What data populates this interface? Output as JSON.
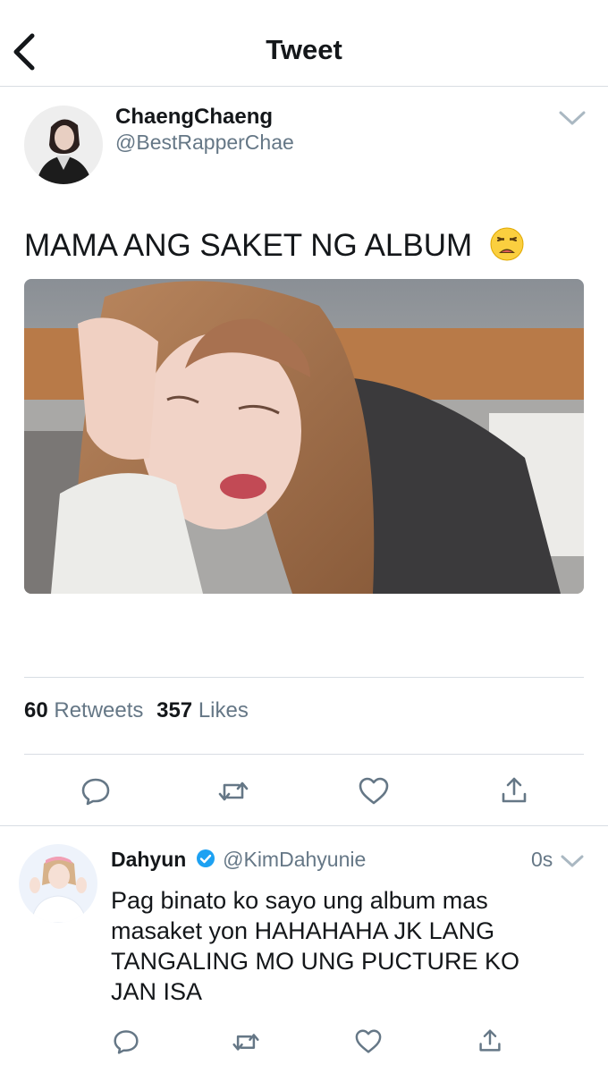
{
  "header": {
    "title": "Tweet"
  },
  "tweet": {
    "display_name": "ChaengChaeng",
    "handle": "@BestRapperChae",
    "text": "MAMA ANG SAKET NG ALBUM",
    "emoji": "😩",
    "stats": {
      "retweets_count": "60",
      "retweets_label": "Retweets",
      "likes_count": "357",
      "likes_label": "Likes"
    }
  },
  "reply": {
    "display_name": "Dahyun",
    "handle": "@KimDahyunie",
    "time": "0s",
    "text_lines": [
      "Pag binato ko sayo ung album mas",
      "masaket yon HAHAHAHA JK LANG",
      "TANGALING MO UNG PUCTURE KO",
      "JAN ISA"
    ]
  },
  "icons": {
    "back": "chevron-left-icon",
    "caret": "chevron-down-icon",
    "reply": "reply-icon",
    "retweet": "retweet-icon",
    "like": "heart-icon",
    "share": "share-icon",
    "verified": "verified-badge-icon"
  },
  "colors": {
    "secondary_text": "#657786",
    "verified": "#1da1f2",
    "divider": "#d8dde3"
  }
}
